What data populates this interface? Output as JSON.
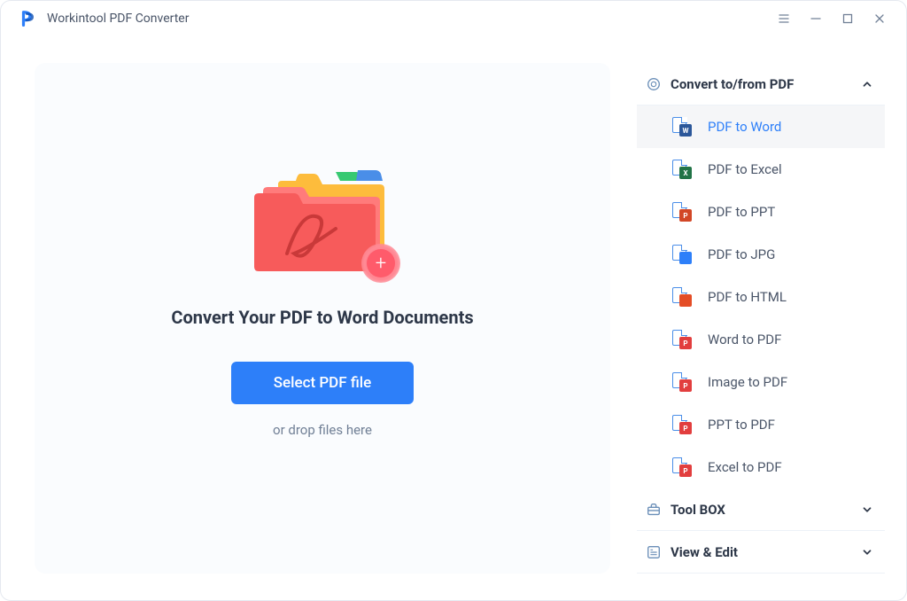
{
  "app": {
    "title": "Workintool PDF Converter"
  },
  "main": {
    "heading": "Convert Your PDF to Word Documents",
    "button": "Select PDF file",
    "drop": "or drop files here"
  },
  "sidebar": {
    "sections": [
      {
        "label": "Convert to/from PDF",
        "expanded": true,
        "items": [
          {
            "label": "PDF to Word",
            "active": true,
            "badge_color": "word",
            "badge_text": "W"
          },
          {
            "label": "PDF to Excel",
            "badge_color": "excel",
            "badge_text": "X"
          },
          {
            "label": "PDF to PPT",
            "badge_color": "ppt",
            "badge_text": "P"
          },
          {
            "label": "PDF to JPG",
            "badge_color": "jpg",
            "badge_text": ""
          },
          {
            "label": "PDF to HTML",
            "badge_color": "html",
            "badge_text": ""
          },
          {
            "label": "Word to PDF",
            "badge_color": "pdf",
            "badge_text": "P"
          },
          {
            "label": "Image to PDF",
            "badge_color": "pdf",
            "badge_text": "P"
          },
          {
            "label": "PPT to PDF",
            "badge_color": "pdf",
            "badge_text": "P"
          },
          {
            "label": "Excel to PDF",
            "badge_color": "pdf",
            "badge_text": "P"
          }
        ]
      },
      {
        "label": "Tool BOX",
        "expanded": false
      },
      {
        "label": "View & Edit",
        "expanded": false
      }
    ]
  }
}
